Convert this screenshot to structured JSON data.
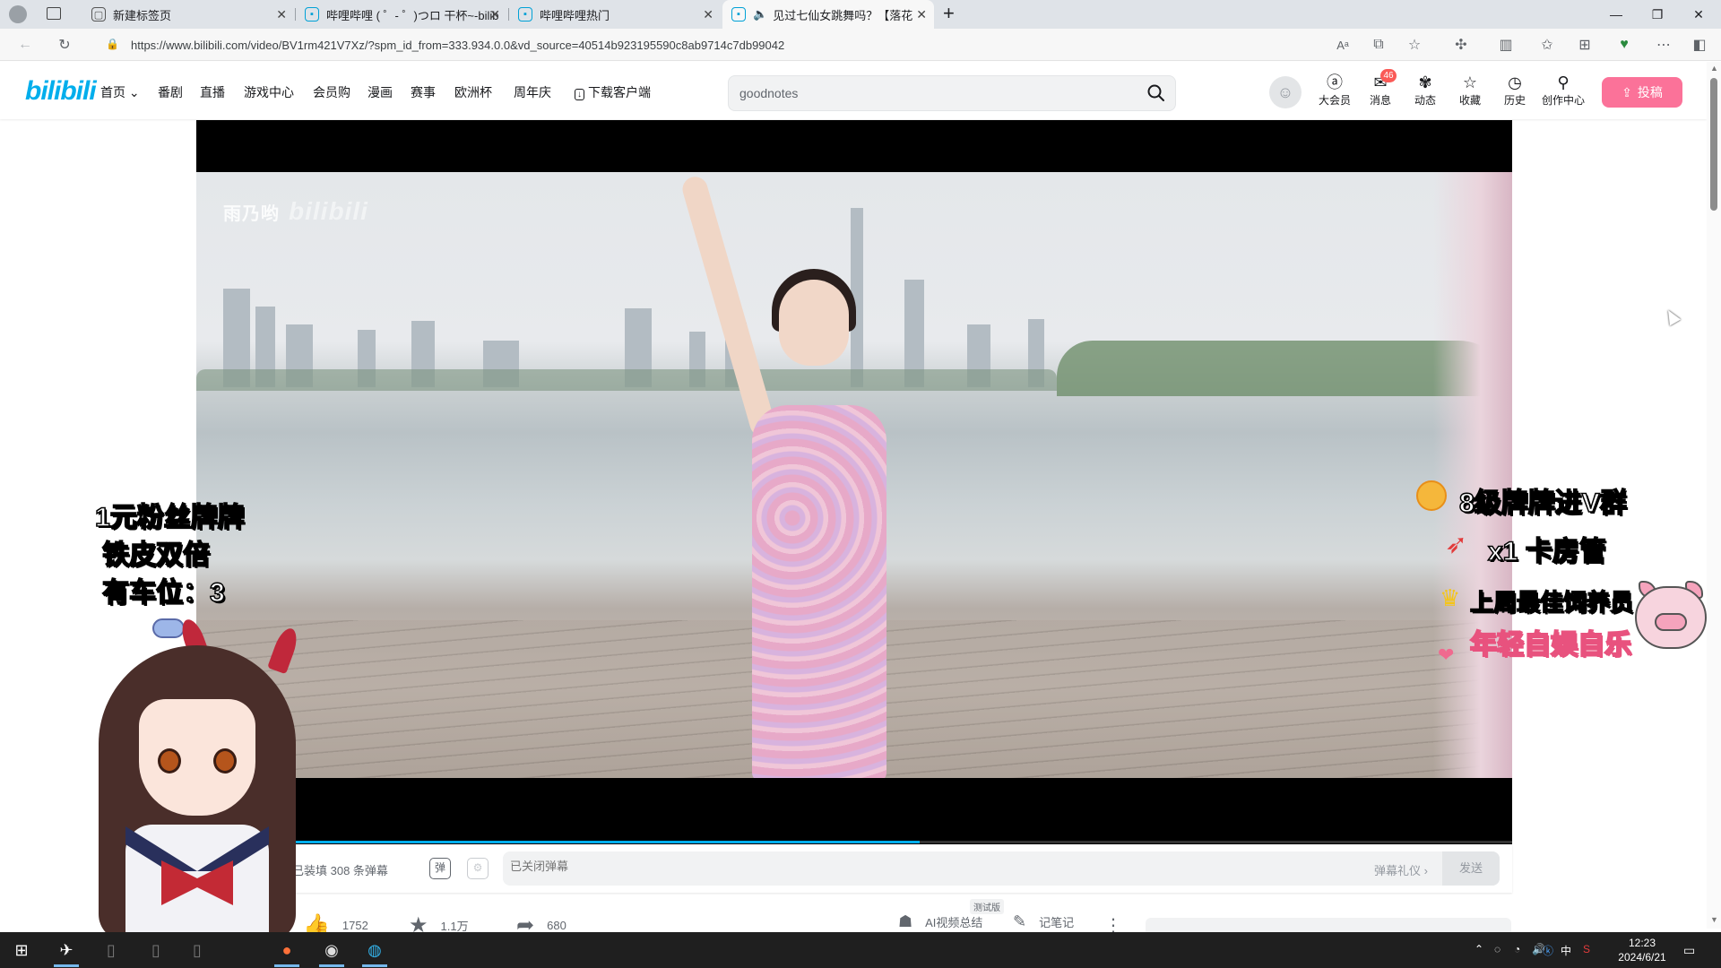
{
  "browser": {
    "tabs": [
      {
        "title": "新建标签页",
        "icon": "new-tab-icon",
        "active": false
      },
      {
        "title": "哔哩哔哩 ( ゜- ゜)つロ 干杯~-bilibili",
        "icon": "bilibili-tv-icon",
        "active": false
      },
      {
        "title": "哔哩哔哩热门",
        "icon": "bilibili-tv-icon",
        "active": false
      },
      {
        "title": "见过七仙女跳舞吗？【落花",
        "icon": "bilibili-tv-icon",
        "active": true
      }
    ],
    "new_tab_label": "+",
    "url": "https://www.bilibili.com/video/BV1rm421V7Xz/?spm_id_from=333.934.0.0&vd_source=40514b923195590c8ab9714c7db99042"
  },
  "header": {
    "logo": "bilibili",
    "nav": [
      "首页",
      "番剧",
      "直播",
      "游戏中心",
      "会员购",
      "漫画",
      "赛事",
      "欧洲杯",
      "周年庆",
      "下载客户端"
    ],
    "search_value": "goodnotes",
    "icons": [
      {
        "label": "大会员",
        "icon": "vip-icon"
      },
      {
        "label": "消息",
        "icon": "message-icon"
      },
      {
        "label": "动态",
        "icon": "dynamic-icon"
      },
      {
        "label": "收藏",
        "icon": "favorite-icon"
      },
      {
        "label": "历史",
        "icon": "history-icon"
      },
      {
        "label": "创作中心",
        "icon": "creator-icon"
      }
    ],
    "message_badge": "46",
    "upload_label": "投稿"
  },
  "player": {
    "watermark": "雨乃哟",
    "watermark_logo": "bilibili",
    "progress_percent": 55
  },
  "danmaku": {
    "viewer_text": "在看，已装填 308 条弹幕",
    "input_placeholder": "已关闭弹幕",
    "etiquette": "弹幕礼仪 ›",
    "send": "发送"
  },
  "stats": {
    "like": "1752",
    "coin": "1.1万",
    "share": "680",
    "ai_summary": "AI视频总结",
    "notes": "记笔记",
    "test_badge": "测试版"
  },
  "overlays": {
    "left_lines": [
      "1元粉丝牌牌",
      "铁皮双倍",
      "有车位：3"
    ],
    "right_lines": [
      "8级牌牌进V群",
      "x1 卡房管",
      "上周最佳饲养员",
      "年轻自娱自乐"
    ]
  },
  "taskbar": {
    "time": "12:23",
    "date": "2024/6/21",
    "ime": "中"
  },
  "colors": {
    "bili_blue": "#00aeec",
    "bili_pink": "#fb7299"
  }
}
